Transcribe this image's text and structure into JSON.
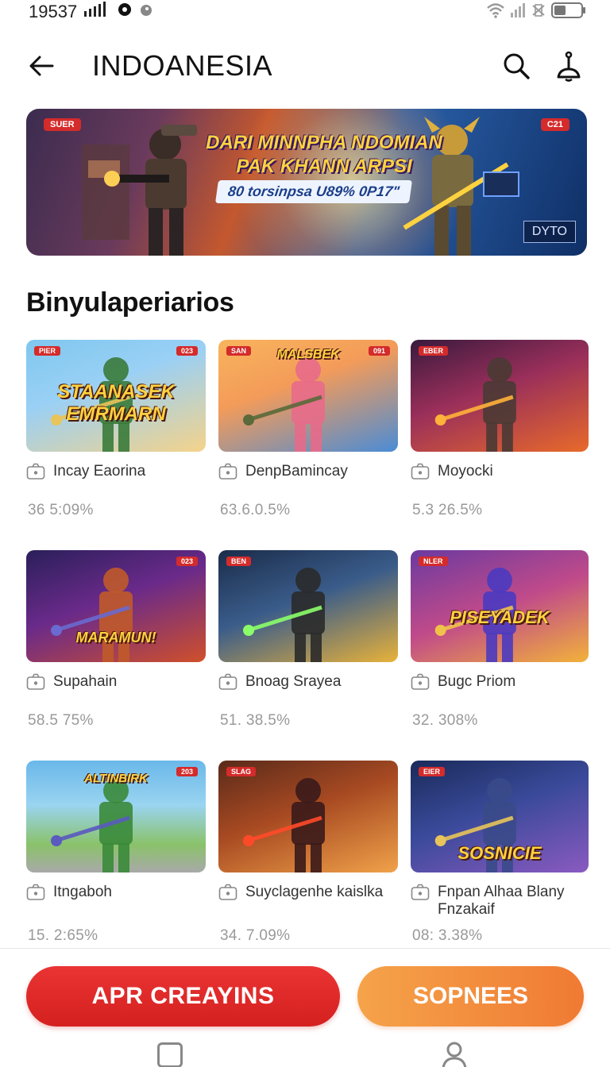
{
  "status_bar": {
    "time": "19537",
    "colors": {
      "icon": "#222222"
    }
  },
  "app_bar": {
    "title": "INDOANESIA",
    "icons": [
      "back-arrow-icon",
      "search-icon",
      "notification-icon"
    ]
  },
  "hero_banner": {
    "badge_left": "SUER",
    "badge_right": "C21",
    "headline_line1": "DARI MINNPHA NDOMIAN",
    "headline_line2": "PAK KHANN ARPSI",
    "subtext": "80 torsinpsa U89% 0P17\"",
    "logo_text": "DYTO"
  },
  "section": {
    "title": "Binyulaperiarios"
  },
  "games": [
    {
      "badge_left": "PIER",
      "badge_right": "023",
      "art_title": "STAANASEK EMRMARN",
      "name": "Incay Eaorina",
      "stat": "36 5:09%",
      "theme": "a"
    },
    {
      "badge_left": "SAN",
      "badge_right": "091",
      "art_title": "MALSBEK",
      "name": "DenpBamincay",
      "stat": "63.6.0.5%",
      "theme": "b"
    },
    {
      "badge_left": "EBER",
      "badge_right": "",
      "art_title": "",
      "name": "Moyocki",
      "stat": "5.3 26.5%",
      "theme": "c"
    },
    {
      "badge_left": "",
      "badge_right": "023",
      "art_title": "MARAMUN!",
      "name": "Supahain",
      "stat": "58.5 75%",
      "theme": "d"
    },
    {
      "badge_left": "BEN",
      "badge_right": "",
      "art_title": "",
      "name": "Bnoag Srayea",
      "stat": "51. 38.5%",
      "theme": "e"
    },
    {
      "badge_left": "NLER",
      "badge_right": "",
      "art_title": "PISEYADEK",
      "name": "Bugc Priom",
      "stat": "32. 308%",
      "theme": "f"
    },
    {
      "badge_left": "",
      "badge_right": "203",
      "art_title": "ALTINBIRK",
      "name": "Itngaboh",
      "stat": "15. 2:65%",
      "theme": "g"
    },
    {
      "badge_left": "SLAG",
      "badge_right": "",
      "art_title": "",
      "name": "Suyclagenhe kaislka",
      "stat": "34. 7.09%",
      "theme": "h"
    },
    {
      "badge_left": "EIER",
      "badge_right": "",
      "art_title": "SOSNICIE",
      "name": "Fnpan Alhaa Blany Fnzakaif",
      "stat": "08: 3.38%",
      "theme": "i"
    }
  ],
  "buttons": {
    "primary": "APR CREAYINS",
    "secondary": "SOPNEES"
  },
  "colors": {
    "primary": "#E02828",
    "secondary": "#F28D3E",
    "badge": "#D42B2B",
    "stat_text": "#999999"
  }
}
